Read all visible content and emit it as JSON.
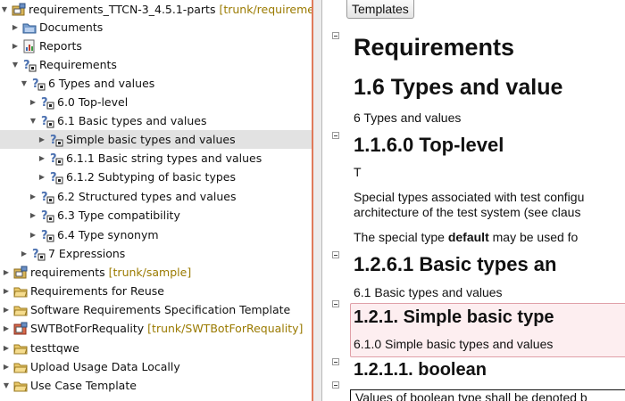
{
  "tree": {
    "rows": [
      {
        "label": "requirements_TTCN-3_4.5.1-parts",
        "decor": "[trunk/requireme",
        "icon": "project-icon"
      },
      {
        "label": "Documents",
        "decor": "",
        "icon": "folder-icon"
      },
      {
        "label": "Reports",
        "decor": "",
        "icon": "report-icon"
      },
      {
        "label": "Requirements",
        "decor": "",
        "icon": "requirement-icon"
      },
      {
        "label": "6 Types and values",
        "decor": "",
        "icon": "requirement-icon"
      },
      {
        "label": "6.0 Top-level",
        "decor": "",
        "icon": "requirement-icon"
      },
      {
        "label": "6.1 Basic types and values",
        "decor": "",
        "icon": "requirement-icon"
      },
      {
        "label": "Simple basic types and values",
        "decor": "",
        "icon": "requirement-icon"
      },
      {
        "label": "6.1.1 Basic string types and values",
        "decor": "",
        "icon": "requirement-icon"
      },
      {
        "label": "6.1.2 Subtyping of basic types",
        "decor": "",
        "icon": "requirement-icon"
      },
      {
        "label": "6.2 Structured types and values",
        "decor": "",
        "icon": "requirement-icon"
      },
      {
        "label": "6.3 Type compatibility",
        "decor": "",
        "icon": "requirement-icon"
      },
      {
        "label": "6.4 Type synonym",
        "decor": "",
        "icon": "requirement-icon"
      },
      {
        "label": "7 Expressions",
        "decor": "",
        "icon": "requirement-icon"
      },
      {
        "label": "requirements",
        "decor": "[trunk/sample]",
        "icon": "project-icon"
      },
      {
        "label": "Requirements for Reuse",
        "decor": "",
        "icon": "folder-icon"
      },
      {
        "label": "Software Requirements Specification Template",
        "decor": "",
        "icon": "folder-icon"
      },
      {
        "label": "SWTBotForRequality",
        "decor": "[trunk/SWTBotForRequality]",
        "icon": "project-icon"
      },
      {
        "label": "testtqwe",
        "decor": "",
        "icon": "folder-icon"
      },
      {
        "label": "Upload Usage Data Locally",
        "decor": "",
        "icon": "folder-icon"
      },
      {
        "label": "Use Case Template",
        "decor": "",
        "icon": "folder-icon"
      }
    ]
  },
  "doc": {
    "templates_label": "Templates",
    "title": "Requirements",
    "h_types": "1.6 Types and value",
    "types_desc": "6 Types and values",
    "h_toplevel": "1.1.6.0 Top-level",
    "toplevel_t": "T",
    "special_para": "Special types associated with test configu architecture of the test system (see claus",
    "default_before": "The special type ",
    "default_bold": "default",
    "default_after": " may be used fo",
    "h_basic": "1.2.6.1 Basic types an",
    "basic_desc": "6.1 Basic types and values",
    "h_simple": "1.2.1. Simple basic type",
    "simple_desc": "6.1.0 Simple basic types and values",
    "h_boolean": "1.2.1.1. boolean",
    "boolean_para": "Values of boolean type shall be denoted b"
  },
  "colors": {
    "selection": "#e2e2e2",
    "decorator": "#9a7a00",
    "sash_accent": "#e07a5a",
    "highlight_fill": "#fdeef0",
    "highlight_border": "#e0a0a8"
  }
}
